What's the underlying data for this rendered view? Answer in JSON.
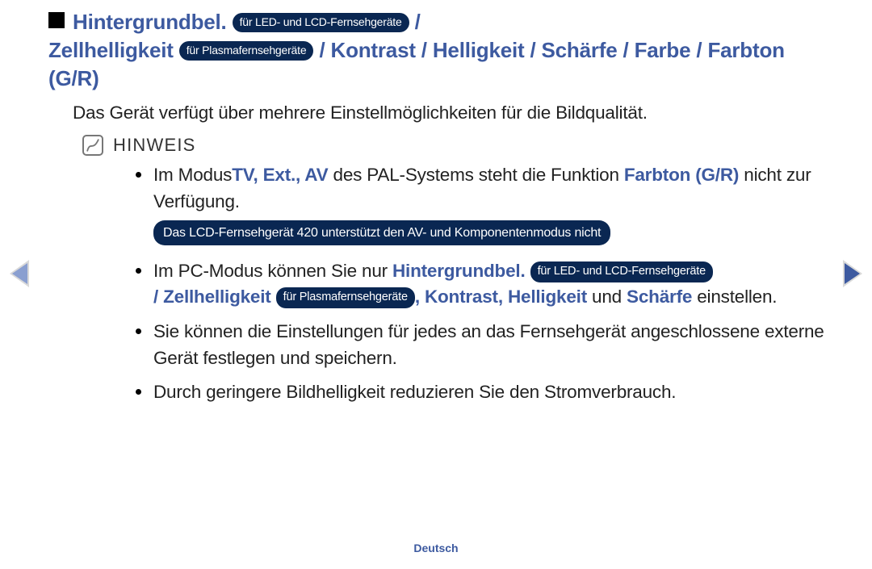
{
  "heading": {
    "item1": "Hintergrundbel.",
    "pill1": "für LED- und LCD-Fernsehgeräte",
    "sep1": " / ",
    "item2": "Zellhelligkeit",
    "pill2": "für Plasmafernsehgeräte",
    "rest": " / Kontrast / Helligkeit / Schärfe / Farbe / Farbton (G/R)"
  },
  "intro": "Das Gerät verfügt über mehrere Einstellmöglichkeiten für die Bildqualität.",
  "hinweis_label": "HINWEIS",
  "bullets": {
    "b1": {
      "t1": "Im Modus",
      "t2": "TV, Ext., AV",
      "t3": " des PAL-Systems steht die Funktion ",
      "t4": "Farbton (G/R)",
      "t5": " nicht zur Verfügung.",
      "pill": "Das LCD-Fernsehgerät 420 unterstützt den AV- und Komponentenmodus nicht"
    },
    "b2": {
      "t1": "Im PC-Modus können Sie nur ",
      "t2": "Hintergrundbel.",
      "pill_led": "für LED- und LCD-Fernsehgeräte",
      "t3": "/ Zellhelligkeit",
      "pill_plasma": "für Plasmafernsehgeräte",
      "t4": ", Kontrast, Helligkeit",
      "t5": " und ",
      "t6": "Schärfe",
      "t7": " einstellen."
    },
    "b3": "Sie können die Einstellungen für jedes an das Fernsehgerät angeschlossene externe Gerät festlegen und speichern.",
    "b4": "Durch geringere Bildhelligkeit reduzieren Sie den Stromverbrauch."
  },
  "footer": "Deutsch"
}
